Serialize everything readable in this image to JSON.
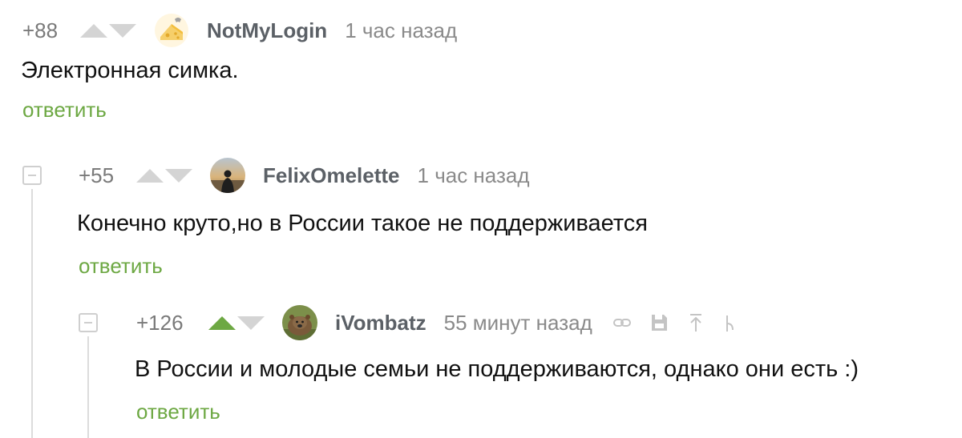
{
  "comments": [
    {
      "rating": "+88",
      "username": "NotMyLogin",
      "time": "1 час назад",
      "text": "Электронная симка.",
      "reply_label": "ответить",
      "avatar": "cheese-avatar-icon"
    },
    {
      "rating": "+55",
      "username": "FelixOmelette",
      "time": "1 час назад",
      "text": "Конечно круто,но в России такое не поддерживается",
      "reply_label": "ответить",
      "avatar": "person-silhouette-avatar-icon"
    },
    {
      "rating": "+126",
      "username": "iVombatz",
      "time": "55 минут назад",
      "text": "В России и молодые семьи не поддерживаются, однако они есть :)",
      "reply_label": "ответить",
      "avatar": "wombat-avatar-icon",
      "upvoted": true,
      "tools": [
        "link-icon",
        "save-icon",
        "parent-comment-icon",
        "branch-icon"
      ]
    }
  ],
  "colors": {
    "accent_green": "#6da843",
    "vote_inactive": "#d4d4d4",
    "username": "#5b6066",
    "meta_gray": "#8a8a8a"
  }
}
